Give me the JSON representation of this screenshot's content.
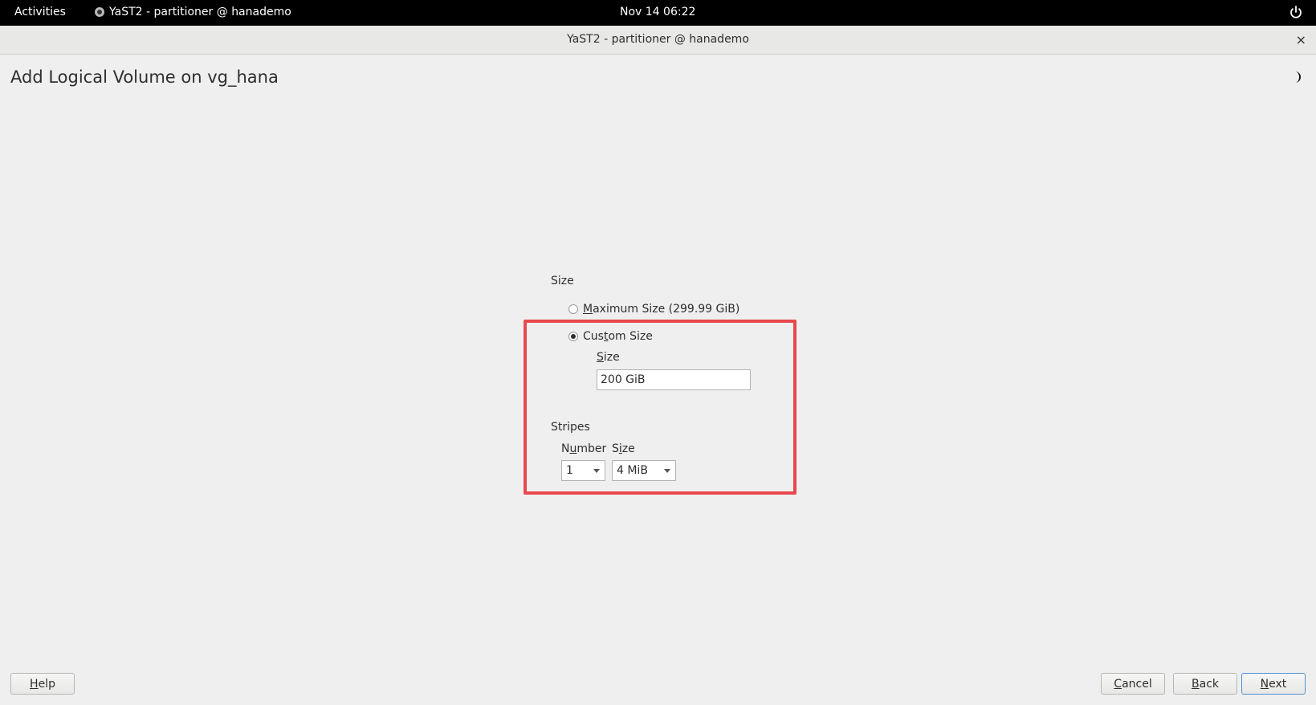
{
  "topbar": {
    "activities": "Activities",
    "app_name": "YaST2 - partitioner @ hanademo",
    "clock": "Nov 14  06:22"
  },
  "window": {
    "title": "YaST2 - partitioner @ hanademo",
    "close": "×"
  },
  "page": {
    "title": "Add Logical Volume on vg_hana"
  },
  "size_section": {
    "label": "Size",
    "max_size_radio": {
      "label_ul": "M",
      "label_rest": "aximum Size (299.99 GiB)",
      "checked": false
    },
    "custom_size_radio": {
      "label_pre": "Cus",
      "label_ul": "t",
      "label_rest": "om Size",
      "checked": true
    },
    "custom_size_label_ul": "S",
    "custom_size_label_rest": "ize",
    "custom_size_value": "200 GiB"
  },
  "stripes": {
    "label": "Stripes",
    "number_label_pre": "N",
    "number_label_ul": "u",
    "number_label_rest": "mber",
    "size_label_pre": "S",
    "size_label_ul": "i",
    "size_label_rest": "ze",
    "number_value": "1",
    "size_value": "4 MiB"
  },
  "buttons": {
    "help_ul": "H",
    "help_rest": "elp",
    "cancel_ul": "C",
    "cancel_rest": "ancel",
    "back_ul": "B",
    "back_rest": "ack",
    "next_ul": "N",
    "next_rest": "ext"
  },
  "colors": {
    "highlight": "#e8484d",
    "default_button_border": "#4a90d9"
  },
  "icons": {
    "app": "yast-icon",
    "power": "power-icon",
    "theme": "moon-icon",
    "close": "close-icon"
  }
}
